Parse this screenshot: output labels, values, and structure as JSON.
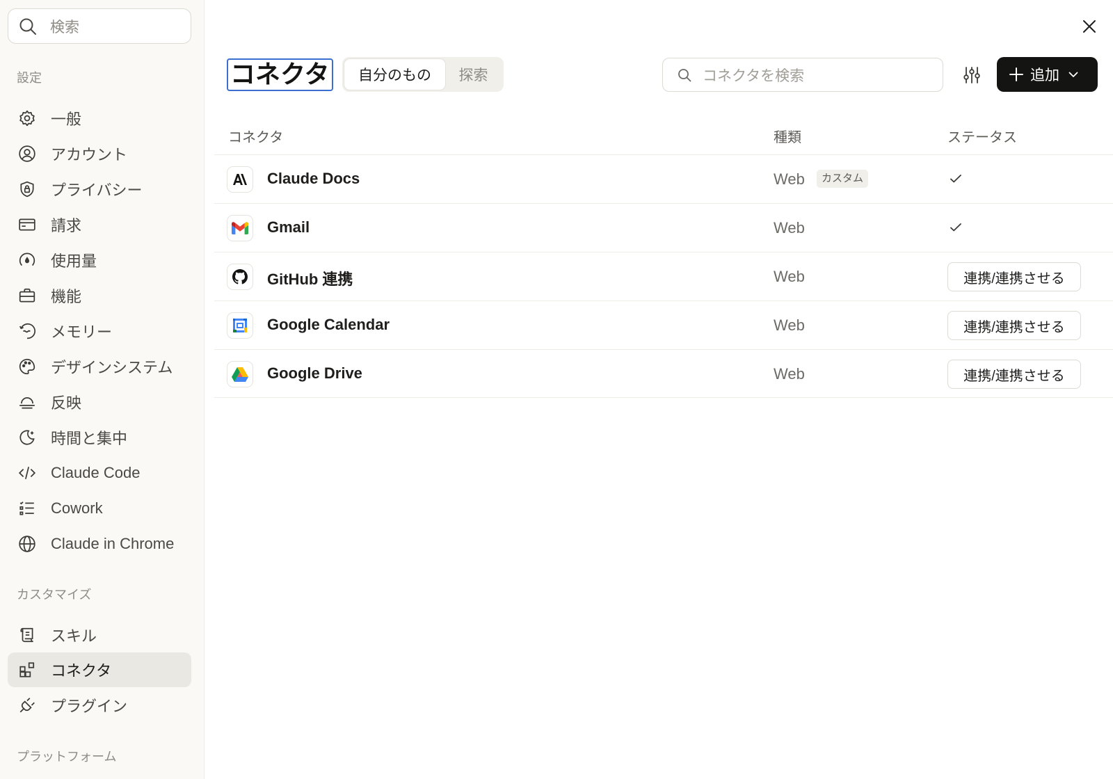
{
  "sidebar": {
    "search_placeholder": "検索",
    "sections": {
      "settings": "設定",
      "customize": "カスタマイズ",
      "platform": "プラットフォーム"
    },
    "items": [
      {
        "label": "一般",
        "icon": "gear-icon"
      },
      {
        "label": "アカウント",
        "icon": "account-icon"
      },
      {
        "label": "プライバシー",
        "icon": "shield-icon"
      },
      {
        "label": "請求",
        "icon": "card-icon"
      },
      {
        "label": "使用量",
        "icon": "gauge-icon"
      },
      {
        "label": "機能",
        "icon": "briefcase-icon"
      },
      {
        "label": "メモリー",
        "icon": "memory-icon"
      },
      {
        "label": "デザインシステム",
        "icon": "palette-icon"
      },
      {
        "label": "反映",
        "icon": "reflection-icon"
      },
      {
        "label": "時間と集中",
        "icon": "moon-icon"
      },
      {
        "label": "Claude Code",
        "icon": "code-icon"
      },
      {
        "label": "Cowork",
        "icon": "list-icon"
      },
      {
        "label": "Claude in Chrome",
        "icon": "globe-icon"
      }
    ],
    "customize_items": [
      {
        "label": "スキル",
        "icon": "scroll-icon"
      },
      {
        "label": "コネクタ",
        "icon": "connector-icon",
        "active": true
      },
      {
        "label": "プラグイン",
        "icon": "plug-icon"
      }
    ]
  },
  "main": {
    "title": "コネクタ",
    "tabs": [
      "自分のもの",
      "探索"
    ],
    "active_tab": "自分のもの",
    "search_placeholder": "コネクタを検索",
    "add_label": "追加",
    "table": {
      "headers": {
        "connector": "コネクタ",
        "type": "種類",
        "status": "ステータス"
      },
      "rows": [
        {
          "name": "Claude Docs",
          "logo": "anthropic-logo-icon",
          "type": "Web",
          "badge": "カスタム",
          "status": "connected"
        },
        {
          "name": "Gmail",
          "logo": "gmail-logo-icon",
          "type": "Web",
          "status": "connected"
        },
        {
          "name": "GitHub 連携",
          "logo": "github-logo-icon",
          "type": "Web",
          "status": "connect",
          "action": "連携/連携させる"
        },
        {
          "name": "Google Calendar",
          "logo": "google-calendar-logo-icon",
          "type": "Web",
          "status": "connect",
          "action": "連携/連携させる"
        },
        {
          "name": "Google Drive",
          "logo": "google-drive-logo-icon",
          "type": "Web",
          "status": "connect",
          "action": "連携/連携させる"
        }
      ]
    }
  },
  "colors": {
    "sidebar_bg": "#faf9f5",
    "active_item_bg": "#e9e8e3",
    "primary_button": "#141413",
    "focus_ring": "#3a6fd1"
  }
}
